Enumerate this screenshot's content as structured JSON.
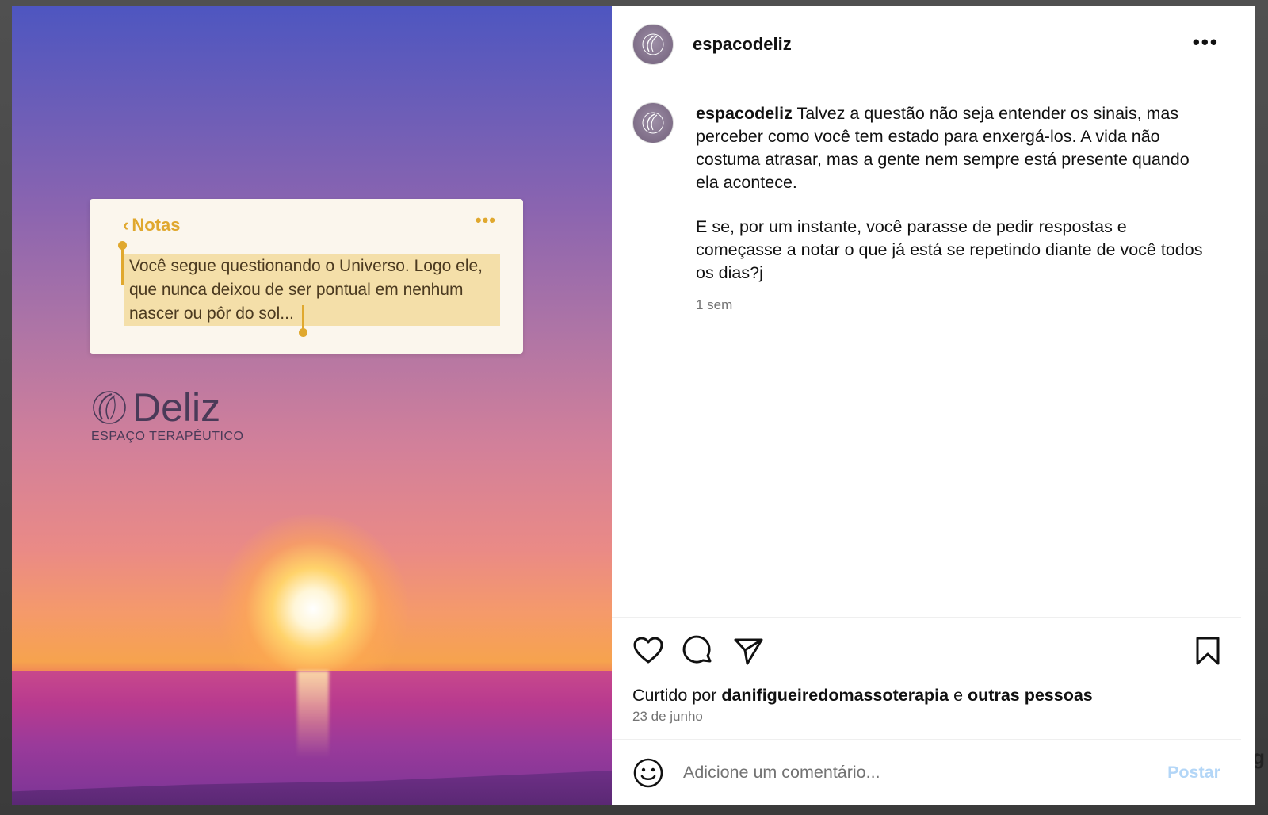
{
  "post": {
    "username": "espacodeliz",
    "more_label": "•••"
  },
  "image": {
    "note_back": "Notas",
    "note_more": "•••",
    "note_text": "Você segue questionando o Universo. Logo ele, que nunca deixou de ser pontual em nenhum nascer ou pôr do sol...",
    "brand_name": "Deliz",
    "brand_sub": "ESPAÇO TERAPÊUTICO"
  },
  "caption": {
    "username": "espacodeliz",
    "paragraph1": "Talvez a questão não seja entender os sinais, mas perceber como você tem estado para enxergá-los. A vida não costuma atrasar, mas a gente nem sempre está presente quando ela acontece.",
    "paragraph2": "E se, por um instante, você parasse de pedir respostas e começasse a notar o que já está se repetindo diante de você todos os dias?j",
    "time": "1 sem"
  },
  "actions": {
    "liked_prefix": "Curtido por",
    "liked_user": "danifigueiredomassoterapia",
    "liked_joiner": "e",
    "liked_others": "outras pessoas",
    "date": "23 de junho"
  },
  "comment": {
    "placeholder": "Adicione um comentário...",
    "post_label": "Postar"
  },
  "background_peek": "g",
  "colors": {
    "accent_notes": "#e0a82e",
    "post_disabled": "#b3d6f7",
    "muted_text": "#737373"
  }
}
